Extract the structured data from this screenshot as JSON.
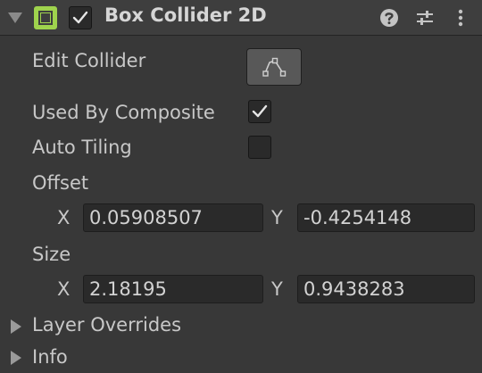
{
  "component": {
    "title": "Box Collider 2D",
    "enabled": true,
    "accent_color": "#9fd34d",
    "icons": {
      "foldout": "chevron-down-icon",
      "component": "box-collider-2d-icon",
      "help": "help-icon",
      "presets": "presets-sliders-icon",
      "menu": "kebab-menu-icon"
    }
  },
  "fields": {
    "edit_collider": {
      "label": "Edit Collider",
      "button_icon": "edit-collider-polygon-icon"
    },
    "used_by_composite": {
      "label": "Used By Composite",
      "checked": true
    },
    "auto_tiling": {
      "label": "Auto Tiling",
      "checked": false
    },
    "offset": {
      "label": "Offset",
      "x_label": "X",
      "x": "0.05908507",
      "y_label": "Y",
      "y": "-0.4254148"
    },
    "size": {
      "label": "Size",
      "x_label": "X",
      "x": "2.18195",
      "y_label": "Y",
      "y": "0.9438283"
    }
  },
  "foldouts": [
    {
      "label": "Layer Overrides"
    },
    {
      "label": "Info"
    }
  ]
}
